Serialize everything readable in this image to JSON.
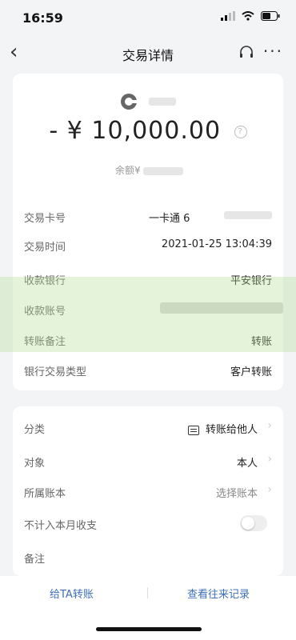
{
  "status": {
    "time": "16:59"
  },
  "nav": {
    "title": "交易详情"
  },
  "summary": {
    "amount": "- ¥ 10,000.00",
    "balance_label": "余额¥"
  },
  "details": [
    {
      "label": "交易卡号",
      "value": "一卡通 6"
    },
    {
      "label": "交易时间",
      "value": "2021-01-25 13:04:39"
    },
    {
      "label": "收款银行",
      "value": "平安银行"
    },
    {
      "label": "收款账号",
      "value": ""
    },
    {
      "label": "转账备注",
      "value": "转账"
    },
    {
      "label": "银行交易类型",
      "value": "客户转账"
    }
  ],
  "category": {
    "label": "分类",
    "value": "转账给他人"
  },
  "target": {
    "label": "对象",
    "value": "本人"
  },
  "ledger": {
    "label": "所属账本",
    "value": "选择账本"
  },
  "exclude": {
    "label": "不计入本月收支"
  },
  "note": {
    "label": "备注"
  },
  "bottom": {
    "left": "给TA转账",
    "right": "查看往来记录"
  },
  "colors": {
    "link": "#3f6fb8",
    "background": "#f3f4f6"
  }
}
